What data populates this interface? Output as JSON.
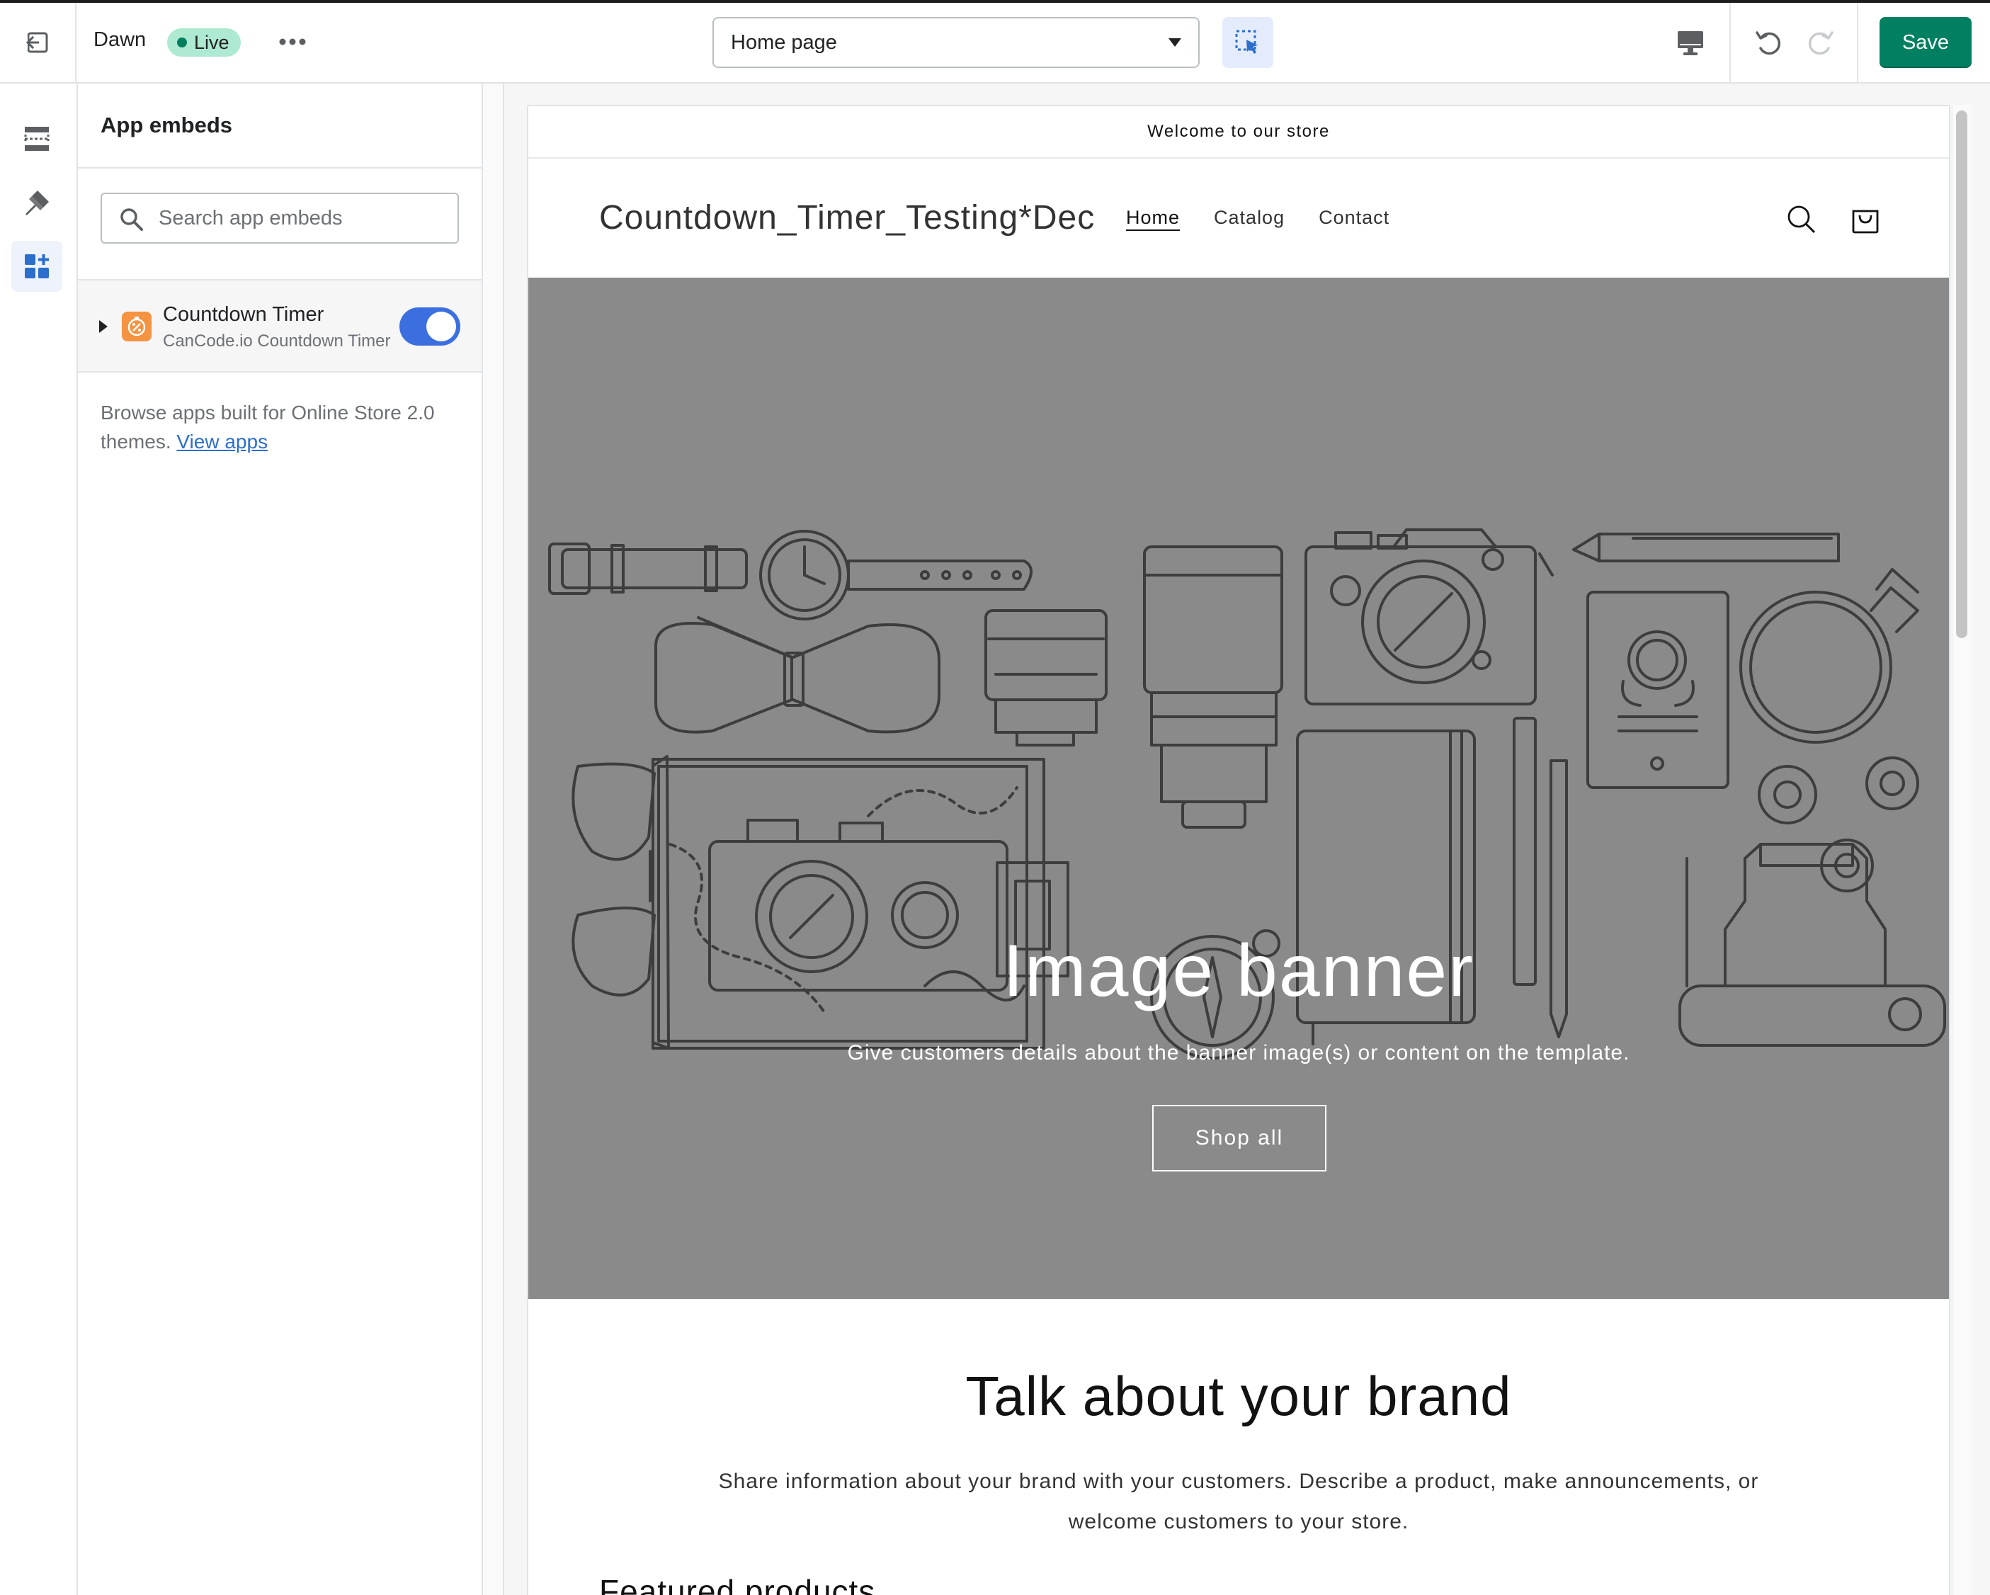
{
  "topbar": {
    "theme_name": "Dawn",
    "status_badge": "Live",
    "page_select_value": "Home page",
    "save_label": "Save"
  },
  "sidebar": {
    "rail_items": [
      "sections-icon",
      "theme-settings-icon",
      "app-embeds-icon"
    ],
    "panel_title": "App embeds",
    "search_placeholder": "Search app embeds",
    "embeds": [
      {
        "name": "Countdown Timer",
        "subtitle": "CanCode.io Countdown Timer",
        "enabled": true
      }
    ],
    "browse_text": "Browse apps built for Online Store 2.0 themes.",
    "browse_link": "View apps"
  },
  "store": {
    "announcement": "Welcome to our store",
    "logo": "Countdown_Timer_Testing*Dec",
    "nav": [
      "Home",
      "Catalog",
      "Contact"
    ],
    "banner_title": "Image banner",
    "banner_subtitle": "Give customers details about the banner image(s) or content on the template.",
    "banner_button": "Shop all",
    "brand_title": "Talk about your brand",
    "brand_text": "Share information about your brand with your customers. Describe a product, make announcements, or welcome customers to your store.",
    "featured_heading": "Featured products"
  },
  "colors": {
    "save_green": "#008060",
    "toggle_blue": "#3b6fe0",
    "live_badge": "#aee9d1",
    "banner_gray": "#8a8a8a",
    "link_blue": "#2c6ecb"
  }
}
